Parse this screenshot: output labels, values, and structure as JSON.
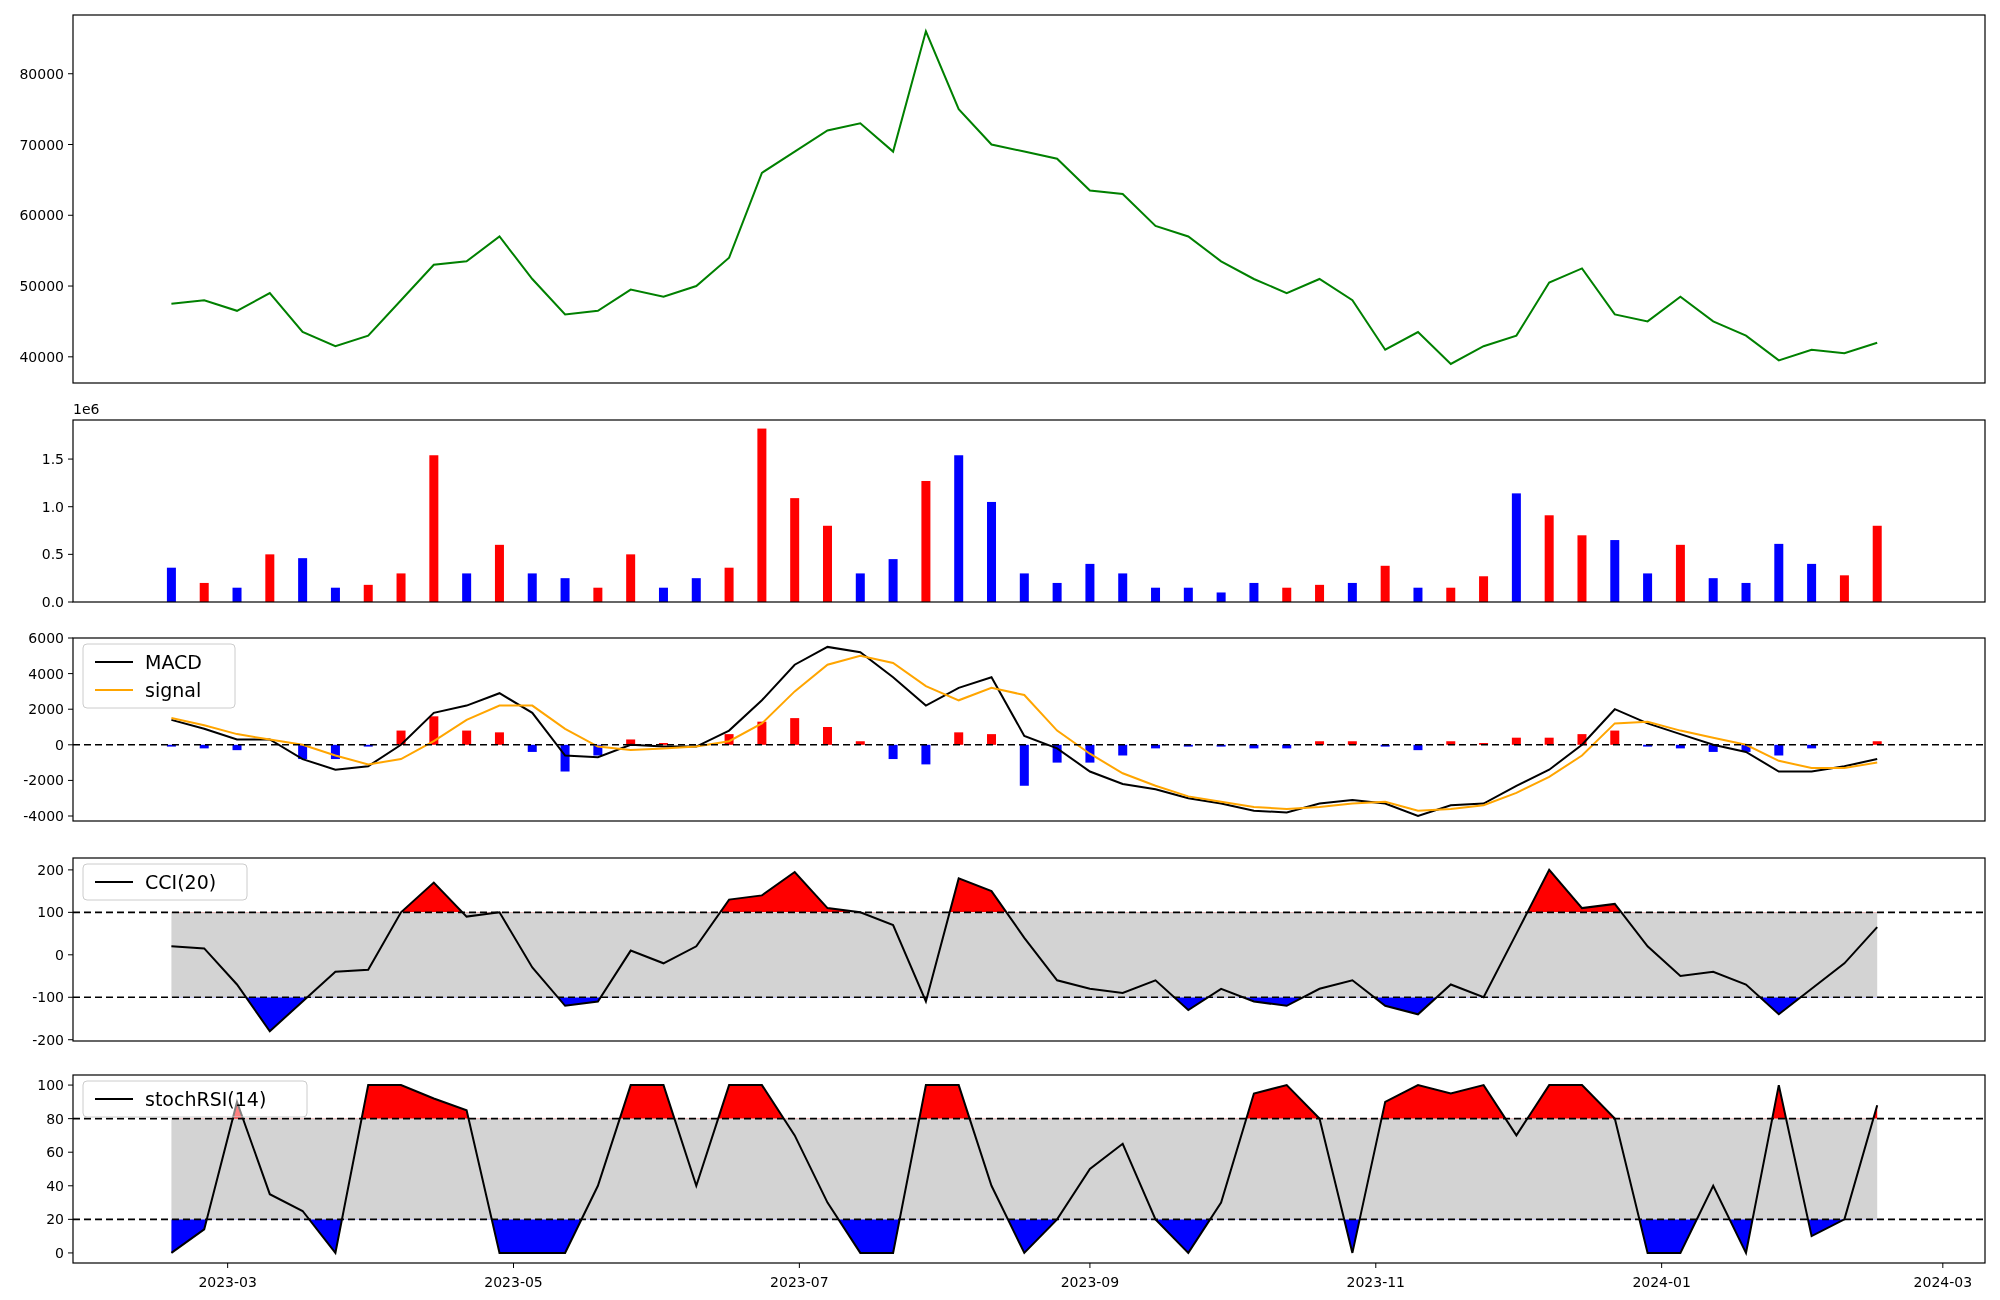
{
  "figure": {
    "panels": [
      {
        "kind": "price",
        "chart_data": {
          "type": "line",
          "x": [
            "2023-02-17",
            "2023-02-24",
            "2023-03-03",
            "2023-03-10",
            "2023-03-17",
            "2023-03-24",
            "2023-03-31",
            "2023-04-07",
            "2023-04-14",
            "2023-04-21",
            "2023-04-28",
            "2023-05-05",
            "2023-05-12",
            "2023-05-19",
            "2023-05-26",
            "2023-06-02",
            "2023-06-09",
            "2023-06-16",
            "2023-06-23",
            "2023-06-30",
            "2023-07-07",
            "2023-07-14",
            "2023-07-21",
            "2023-07-28",
            "2023-08-04",
            "2023-08-11",
            "2023-08-18",
            "2023-08-25",
            "2023-09-01",
            "2023-09-08",
            "2023-09-15",
            "2023-09-22",
            "2023-09-29",
            "2023-10-06",
            "2023-10-13",
            "2023-10-20",
            "2023-10-27",
            "2023-11-03",
            "2023-11-10",
            "2023-11-17",
            "2023-11-24",
            "2023-12-01",
            "2023-12-08",
            "2023-12-15",
            "2023-12-22",
            "2023-12-29",
            "2024-01-05",
            "2024-01-12",
            "2024-01-19",
            "2024-01-26",
            "2024-02-02",
            "2024-02-09",
            "2024-02-16"
          ],
          "series": [
            {
              "color": "#008000",
              "values": [
                47500,
                48000,
                46500,
                49000,
                43500,
                41500,
                43000,
                48000,
                53000,
                53500,
                57000,
                51000,
                46000,
                46500,
                49500,
                48500,
                50000,
                54000,
                66000,
                69000,
                72000,
                73000,
                69000,
                86000,
                75000,
                70000,
                69000,
                68000,
                63500,
                63000,
                58500,
                57000,
                53500,
                51000,
                49000,
                51000,
                48000,
                41000,
                43500,
                39000,
                41500,
                43000,
                50500,
                52500,
                46000,
                45000,
                48500,
                45000,
                43000,
                39500,
                41000,
                40500,
                42000
              ]
            }
          ],
          "xlim": [
            "2023-01-27",
            "2024-03-10"
          ],
          "ylim": [
            36300,
            88300
          ],
          "yticks": [
            40000,
            50000,
            60000,
            70000,
            80000
          ]
        }
      },
      {
        "kind": "volume",
        "offset_label": "1e6",
        "chart_data": {
          "type": "bar",
          "x": [
            "2023-02-17",
            "2023-02-24",
            "2023-03-03",
            "2023-03-10",
            "2023-03-17",
            "2023-03-24",
            "2023-03-31",
            "2023-04-07",
            "2023-04-14",
            "2023-04-21",
            "2023-04-28",
            "2023-05-05",
            "2023-05-12",
            "2023-05-19",
            "2023-05-26",
            "2023-06-02",
            "2023-06-09",
            "2023-06-16",
            "2023-06-23",
            "2023-06-30",
            "2023-07-07",
            "2023-07-14",
            "2023-07-21",
            "2023-07-28",
            "2023-08-04",
            "2023-08-11",
            "2023-08-18",
            "2023-08-25",
            "2023-09-01",
            "2023-09-08",
            "2023-09-15",
            "2023-09-22",
            "2023-09-29",
            "2023-10-06",
            "2023-10-13",
            "2023-10-20",
            "2023-10-27",
            "2023-11-03",
            "2023-11-10",
            "2023-11-17",
            "2023-11-24",
            "2023-12-01",
            "2023-12-08",
            "2023-12-15",
            "2023-12-22",
            "2023-12-29",
            "2024-01-05",
            "2024-01-12",
            "2024-01-19",
            "2024-01-26",
            "2024-02-02",
            "2024-02-09",
            "2024-02-16"
          ],
          "series": [
            {
              "color": "#ff0000",
              "values": [
                null,
                0.2,
                null,
                0.5,
                null,
                null,
                0.18,
                0.3,
                1.54,
                null,
                0.6,
                null,
                null,
                0.15,
                0.5,
                null,
                null,
                0.36,
                1.82,
                1.09,
                0.8,
                null,
                null,
                1.27,
                null,
                null,
                null,
                null,
                null,
                null,
                null,
                null,
                null,
                null,
                0.15,
                0.18,
                null,
                0.38,
                null,
                0.15,
                0.27,
                null,
                0.91,
                0.7,
                null,
                null,
                0.6,
                null,
                null,
                null,
                null,
                0.28,
                0.8
              ]
            },
            {
              "color": "#0000ff",
              "values": [
                0.36,
                null,
                0.15,
                null,
                0.46,
                0.15,
                null,
                null,
                null,
                0.3,
                null,
                0.3,
                0.25,
                null,
                null,
                0.15,
                0.25,
                null,
                null,
                null,
                null,
                0.3,
                0.45,
                null,
                1.54,
                1.05,
                0.3,
                0.2,
                0.4,
                0.3,
                0.15,
                0.15,
                0.1,
                0.2,
                null,
                null,
                0.2,
                null,
                0.15,
                null,
                null,
                1.14,
                null,
                null,
                0.65,
                0.3,
                null,
                0.25,
                0.2,
                0.61,
                0.4,
                null,
                null
              ]
            }
          ],
          "xlim": [
            "2023-01-27",
            "2024-03-10"
          ],
          "ylim": [
            0,
            1.91
          ],
          "yticks": [
            {
              "value": 0,
              "label": "0.0"
            },
            {
              "value": 0.5,
              "label": "0.5"
            },
            {
              "value": 1,
              "label": "1.0"
            },
            {
              "value": 1.5,
              "label": "1.5"
            }
          ]
        }
      },
      {
        "kind": "macd",
        "chart_data": {
          "type": "line",
          "x": [
            "2023-02-17",
            "2023-02-24",
            "2023-03-03",
            "2023-03-10",
            "2023-03-17",
            "2023-03-24",
            "2023-03-31",
            "2023-04-07",
            "2023-04-14",
            "2023-04-21",
            "2023-04-28",
            "2023-05-05",
            "2023-05-12",
            "2023-05-19",
            "2023-05-26",
            "2023-06-02",
            "2023-06-09",
            "2023-06-16",
            "2023-06-23",
            "2023-06-30",
            "2023-07-07",
            "2023-07-14",
            "2023-07-21",
            "2023-07-28",
            "2023-08-04",
            "2023-08-11",
            "2023-08-18",
            "2023-08-25",
            "2023-09-01",
            "2023-09-08",
            "2023-09-15",
            "2023-09-22",
            "2023-09-29",
            "2023-10-06",
            "2023-10-13",
            "2023-10-20",
            "2023-10-27",
            "2023-11-03",
            "2023-11-10",
            "2023-11-17",
            "2023-11-24",
            "2023-12-01",
            "2023-12-08",
            "2023-12-15",
            "2023-12-22",
            "2023-12-29",
            "2024-01-05",
            "2024-01-12",
            "2024-01-19",
            "2024-01-26",
            "2024-02-02",
            "2024-02-09",
            "2024-02-16"
          ],
          "series": [
            {
              "name": "MACD",
              "color": "#000000",
              "values": [
                1400,
                900,
                300,
                300,
                -800,
                -1400,
                -1200,
                0,
                1800,
                2200,
                2900,
                1800,
                -600,
                -700,
                0,
                -100,
                -100,
                800,
                2500,
                4500,
                5500,
                5200,
                3800,
                2200,
                3200,
                3800,
                500,
                -200,
                -1500,
                -2200,
                -2500,
                -3000,
                -3300,
                -3700,
                -3800,
                -3300,
                -3100,
                -3300,
                -4000,
                -3400,
                -3300,
                -2300,
                -1400,
                0,
                2000,
                1200,
                600,
                0,
                -400,
                -1500,
                -1500,
                -1200,
                -800
              ]
            },
            {
              "name": "signal",
              "color": "#ffa500",
              "values": [
                1500,
                1100,
                600,
                300,
                0,
                -600,
                -1100,
                -800,
                200,
                1400,
                2200,
                2200,
                900,
                -100,
                -300,
                -200,
                -100,
                200,
                1200,
                3000,
                4500,
                5000,
                4600,
                3300,
                2500,
                3200,
                2800,
                800,
                -500,
                -1600,
                -2300,
                -2900,
                -3200,
                -3500,
                -3600,
                -3500,
                -3300,
                -3200,
                -3700,
                -3600,
                -3400,
                -2700,
                -1800,
                -600,
                1200,
                1300,
                800,
                400,
                0,
                -900,
                -1300,
                -1300,
                -1000
              ]
            },
            {
              "type": "bar",
              "color": "#ff0000",
              "values": [
                null,
                null,
                null,
                null,
                null,
                null,
                null,
                800,
                1600,
                800,
                700,
                null,
                null,
                null,
                300,
                100,
                null,
                600,
                1300,
                1500,
                1000,
                200,
                null,
                null,
                700,
                600,
                null,
                null,
                null,
                null,
                null,
                null,
                null,
                null,
                null,
                200,
                200,
                null,
                null,
                200,
                100,
                400,
                400,
                600,
                800,
                null,
                null,
                null,
                null,
                null,
                null,
                null,
                200
              ]
            },
            {
              "type": "bar",
              "color": "#0000ff",
              "values": [
                -100,
                -200,
                -300,
                null,
                -800,
                -800,
                -100,
                null,
                null,
                null,
                null,
                -400,
                -1500,
                -600,
                null,
                null,
                null,
                null,
                null,
                null,
                null,
                null,
                -800,
                -1100,
                null,
                null,
                -2300,
                -1000,
                -1000,
                -600,
                -200,
                -100,
                -100,
                -200,
                -200,
                null,
                null,
                -100,
                -300,
                null,
                null,
                null,
                null,
                null,
                null,
                -100,
                -200,
                -400,
                -400,
                -600,
                -200,
                null,
                null
              ]
            }
          ],
          "xlim": [
            "2023-01-27",
            "2024-03-10"
          ],
          "ylim": [
            -4280,
            6000
          ],
          "yticks": [
            -4000,
            -2000,
            0,
            2000,
            4000,
            6000
          ],
          "ref_lines": [
            {
              "axis": "y",
              "value": 0
            }
          ],
          "legend": true
        }
      },
      {
        "kind": "oscillator",
        "chart_data": {
          "type": "line",
          "x": [
            "2023-02-17",
            "2023-02-24",
            "2023-03-03",
            "2023-03-10",
            "2023-03-17",
            "2023-03-24",
            "2023-03-31",
            "2023-04-07",
            "2023-04-14",
            "2023-04-21",
            "2023-04-28",
            "2023-05-05",
            "2023-05-12",
            "2023-05-19",
            "2023-05-26",
            "2023-06-02",
            "2023-06-09",
            "2023-06-16",
            "2023-06-23",
            "2023-06-30",
            "2023-07-07",
            "2023-07-14",
            "2023-07-21",
            "2023-07-28",
            "2023-08-04",
            "2023-08-11",
            "2023-08-18",
            "2023-08-25",
            "2023-09-01",
            "2023-09-08",
            "2023-09-15",
            "2023-09-22",
            "2023-09-29",
            "2023-10-06",
            "2023-10-13",
            "2023-10-20",
            "2023-10-27",
            "2023-11-03",
            "2023-11-10",
            "2023-11-17",
            "2023-11-24",
            "2023-12-01",
            "2023-12-08",
            "2023-12-15",
            "2023-12-22",
            "2023-12-29",
            "2024-01-05",
            "2024-01-12",
            "2024-01-19",
            "2024-01-26",
            "2024-02-02",
            "2024-02-09",
            "2024-02-16"
          ],
          "series": [
            {
              "name": "CCI(20)",
              "color": "#000000",
              "values": [
                20,
                15,
                -70,
                -180,
                -110,
                -40,
                -35,
                100,
                170,
                90,
                100,
                -30,
                -120,
                -110,
                10,
                -20,
                20,
                130,
                140,
                195,
                110,
                100,
                70,
                -110,
                180,
                150,
                40,
                -60,
                -80,
                -90,
                -60,
                -130,
                -80,
                -110,
                -120,
                -80,
                -60,
                -120,
                -140,
                -70,
                -100,
                50,
                200,
                110,
                120,
                20,
                -50,
                -40,
                -70,
                -140,
                -80,
                -20,
                65
              ]
            }
          ],
          "xlim": [
            "2023-01-27",
            "2024-03-10"
          ],
          "ylim": [
            -203,
            228
          ],
          "yticks": [
            -200,
            -100,
            0,
            100,
            200
          ],
          "ref_lines": [
            {
              "axis": "y",
              "value": 100
            },
            {
              "axis": "y",
              "value": -100
            }
          ],
          "bands": [
            {
              "axis": "y",
              "from": -100,
              "to": 100,
              "color": "#d3d3d3"
            }
          ],
          "legend": true
        }
      },
      {
        "kind": "oscillator",
        "chart_data": {
          "type": "line",
          "x": [
            "2023-02-17",
            "2023-02-24",
            "2023-03-03",
            "2023-03-10",
            "2023-03-17",
            "2023-03-24",
            "2023-03-31",
            "2023-04-07",
            "2023-04-14",
            "2023-04-21",
            "2023-04-28",
            "2023-05-05",
            "2023-05-12",
            "2023-05-19",
            "2023-05-26",
            "2023-06-02",
            "2023-06-09",
            "2023-06-16",
            "2023-06-23",
            "2023-06-30",
            "2023-07-07",
            "2023-07-14",
            "2023-07-21",
            "2023-07-28",
            "2023-08-04",
            "2023-08-11",
            "2023-08-18",
            "2023-08-25",
            "2023-09-01",
            "2023-09-08",
            "2023-09-15",
            "2023-09-22",
            "2023-09-29",
            "2023-10-06",
            "2023-10-13",
            "2023-10-20",
            "2023-10-27",
            "2023-11-03",
            "2023-11-10",
            "2023-11-17",
            "2023-11-24",
            "2023-12-01",
            "2023-12-08",
            "2023-12-15",
            "2023-12-22",
            "2023-12-29",
            "2024-01-05",
            "2024-01-12",
            "2024-01-19",
            "2024-01-26",
            "2024-02-02",
            "2024-02-09",
            "2024-02-16"
          ],
          "series": [
            {
              "name": "stochRSI(14)",
              "color": "#000000",
              "values": [
                0,
                14,
                90,
                35,
                25,
                0,
                100,
                100,
                92,
                85,
                0,
                0,
                0,
                40,
                100,
                100,
                40,
                100,
                100,
                70,
                30,
                0,
                0,
                100,
                100,
                40,
                0,
                20,
                50,
                65,
                20,
                0,
                30,
                95,
                100,
                80,
                0,
                90,
                100,
                95,
                100,
                70,
                100,
                100,
                80,
                0,
                0,
                40,
                0,
                100,
                10,
                20,
                88
              ]
            }
          ],
          "xlim": [
            "2023-01-27",
            "2024-03-10"
          ],
          "ylim": [
            -6,
            106
          ],
          "yticks": [
            0,
            20,
            40,
            60,
            80,
            100
          ],
          "xticks": [
            {
              "value": "2023-03-01",
              "label": "2023-03"
            },
            {
              "value": "2023-05-01",
              "label": "2023-05"
            },
            {
              "value": "2023-07-01",
              "label": "2023-07"
            },
            {
              "value": "2023-09-01",
              "label": "2023-09"
            },
            {
              "value": "2023-11-01",
              "label": "2023-11"
            },
            {
              "value": "2024-01-01",
              "label": "2024-01"
            },
            {
              "value": "2024-03-01",
              "label": "2024-03"
            }
          ],
          "ref_lines": [
            {
              "axis": "y",
              "value": 80
            },
            {
              "axis": "y",
              "value": 20
            }
          ],
          "bands": [
            {
              "axis": "y",
              "from": 20,
              "to": 80,
              "color": "#d3d3d3"
            }
          ],
          "legend": true
        }
      }
    ]
  }
}
